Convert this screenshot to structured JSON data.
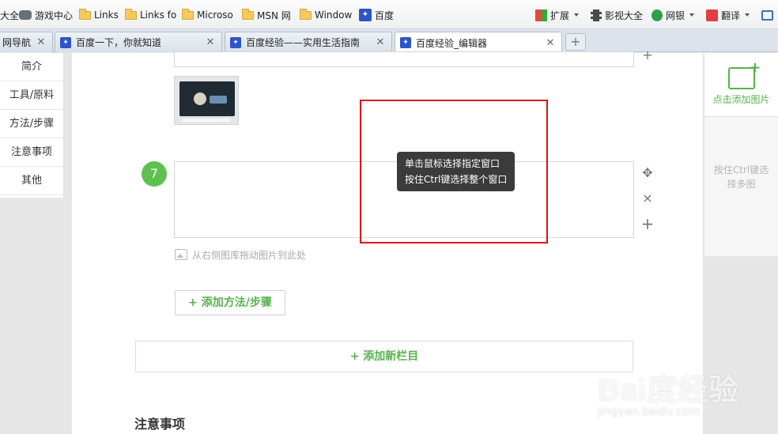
{
  "bookmarks": {
    "items": [
      {
        "label": "大全",
        "icon": "none"
      },
      {
        "label": "游戏中心",
        "icon": "gamepad-icon"
      },
      {
        "label": "Links",
        "icon": "folder-icon"
      },
      {
        "label": "Links fo",
        "icon": "folder-icon"
      },
      {
        "label": "Microso",
        "icon": "folder-icon"
      },
      {
        "label": "MSN 网",
        "icon": "folder-icon"
      },
      {
        "label": "Window",
        "icon": "folder-icon"
      },
      {
        "label": "百度",
        "icon": "baidu-paw-icon"
      }
    ],
    "right_items": [
      {
        "label": "扩展",
        "icon": "extensions-grid-icon"
      },
      {
        "label": "影视大全",
        "icon": "film-icon"
      },
      {
        "label": "网银",
        "icon": "bank-shield-icon"
      },
      {
        "label": "翻译",
        "icon": "translate-icon"
      }
    ]
  },
  "tabs": [
    {
      "label": "网导航"
    },
    {
      "label": "百度一下，你就知道"
    },
    {
      "label": "百度经验——实用生活指南"
    },
    {
      "label": "百度经验_编辑器"
    }
  ],
  "new_tab_label": "+",
  "left_nav": [
    "简介",
    "工具/原料",
    "方法/步骤",
    "注意事项",
    "其他"
  ],
  "editor": {
    "step_number": "7",
    "image_hint": "从右侧图库拖动图片到此处",
    "add_step": "+ 添加方法/步骤",
    "add_section": "+  添加新栏目",
    "notes_heading": "注意事项",
    "tools": {
      "move": "✥",
      "delete": "×",
      "add": "+"
    }
  },
  "tooltip": {
    "line1": "单击鼠标选择指定窗口",
    "line2": "按住Ctrl键选择整个窗口"
  },
  "right_panel": {
    "add_image": "点击添加图片",
    "multi_select": "按住Ctrl键选择多图"
  },
  "watermark": {
    "logo": "Bai度经验",
    "url": "jingyan.baidu.com"
  },
  "colors": {
    "accent_green": "#55b34a",
    "step_badge": "#5cc14f",
    "highlight_red": "#e01010",
    "tooltip_bg": "#3b3b3b"
  }
}
